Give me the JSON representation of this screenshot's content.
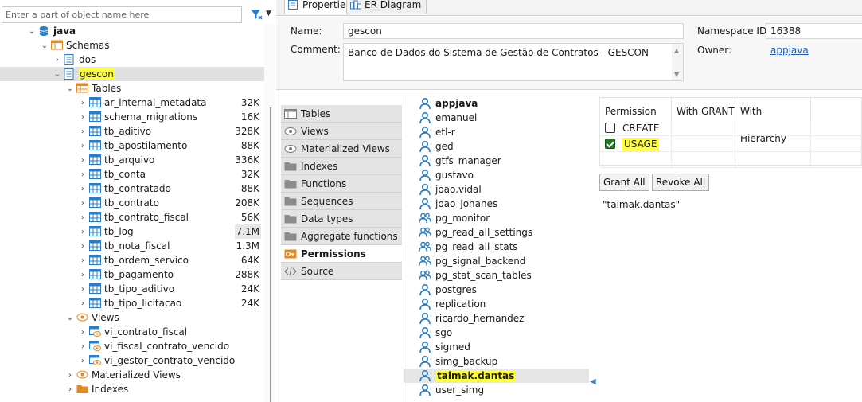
{
  "navigator": {
    "filter_placeholder": "Enter a part of object name here",
    "tree": {
      "database": "java",
      "schemas_label": "Schemas",
      "schemas": [
        "dos",
        "gescon"
      ],
      "tables_label": "Tables",
      "tables": [
        {
          "name": "ar_internal_metadata",
          "size": "32K"
        },
        {
          "name": "schema_migrations",
          "size": "16K"
        },
        {
          "name": "tb_aditivo",
          "size": "328K"
        },
        {
          "name": "tb_apostilamento",
          "size": "88K"
        },
        {
          "name": "tb_arquivo",
          "size": "336K"
        },
        {
          "name": "tb_conta",
          "size": "32K"
        },
        {
          "name": "tb_contratado",
          "size": "88K"
        },
        {
          "name": "tb_contrato",
          "size": "208K"
        },
        {
          "name": "tb_contrato_fiscal",
          "size": "56K"
        },
        {
          "name": "tb_log",
          "size": "7.1M"
        },
        {
          "name": "tb_nota_fiscal",
          "size": "1.3M"
        },
        {
          "name": "tb_ordem_servico",
          "size": "64K"
        },
        {
          "name": "tb_pagamento",
          "size": "288K"
        },
        {
          "name": "tb_tipo_aditivo",
          "size": "24K"
        },
        {
          "name": "tb_tipo_licitacao",
          "size": "24K"
        }
      ],
      "views_label": "Views",
      "views": [
        "vi_contrato_fiscal",
        "vi_fiscal_contrato_vencido",
        "vi_gestor_contrato_vencido"
      ],
      "materialized_views_label": "Materialized Views",
      "indexes_label": "Indexes"
    }
  },
  "editor": {
    "tabs": [
      "Properties",
      "ER Diagram"
    ],
    "properties": {
      "name_label": "Name:",
      "name_value": "gescon",
      "comment_label": "Comment:",
      "comment_value": "Banco de Dados do Sistema de Gestão de Contratos - GESCON",
      "namespace_label": "Namespace ID:",
      "namespace_value": "16388",
      "owner_label": "Owner:",
      "owner_value": "appjava"
    },
    "subtabs": [
      {
        "label": "Tables",
        "icon": "table-icon"
      },
      {
        "label": "Views",
        "icon": "eye-icon"
      },
      {
        "label": "Materialized Views",
        "icon": "eye-icon"
      },
      {
        "label": "Indexes",
        "icon": "folder-icon"
      },
      {
        "label": "Functions",
        "icon": "folder-icon"
      },
      {
        "label": "Sequences",
        "icon": "folder-icon"
      },
      {
        "label": "Data types",
        "icon": "folder-icon"
      },
      {
        "label": "Aggregate functions",
        "icon": "folder-icon"
      },
      {
        "label": "Permissions",
        "icon": "key-icon"
      },
      {
        "label": "Source",
        "icon": "source-icon"
      }
    ],
    "users": [
      {
        "name": "appjava",
        "kind": "user",
        "bold": true
      },
      {
        "name": "emanuel",
        "kind": "user"
      },
      {
        "name": "etl-r",
        "kind": "user"
      },
      {
        "name": "ged",
        "kind": "user"
      },
      {
        "name": "gtfs_manager",
        "kind": "user"
      },
      {
        "name": "gustavo",
        "kind": "user"
      },
      {
        "name": "joao.vidal",
        "kind": "user"
      },
      {
        "name": "joao_johanes",
        "kind": "user"
      },
      {
        "name": "pg_monitor",
        "kind": "group"
      },
      {
        "name": "pg_read_all_settings",
        "kind": "group"
      },
      {
        "name": "pg_read_all_stats",
        "kind": "group"
      },
      {
        "name": "pg_signal_backend",
        "kind": "group"
      },
      {
        "name": "pg_stat_scan_tables",
        "kind": "group"
      },
      {
        "name": "postgres",
        "kind": "user"
      },
      {
        "name": "replication",
        "kind": "user"
      },
      {
        "name": "ricardo_hernandez",
        "kind": "user"
      },
      {
        "name": "sgo",
        "kind": "user"
      },
      {
        "name": "sigmed",
        "kind": "user"
      },
      {
        "name": "simg_backup",
        "kind": "user"
      },
      {
        "name": "taimak.dantas",
        "kind": "user",
        "bold": true
      },
      {
        "name": "user_simg",
        "kind": "user"
      }
    ],
    "permissions": {
      "headers": [
        "Permission",
        "With GRANT",
        "With Hierarchy"
      ],
      "rows": [
        {
          "name": "CREATE",
          "checked": false
        },
        {
          "name": "USAGE",
          "checked": true
        }
      ],
      "grant_all": "Grant All",
      "revoke_all": "Revoke All",
      "grantee": "\"taimak.dantas\""
    }
  },
  "colors": {
    "highlight": "#ffff33",
    "link": "#1f5fbf",
    "check": "#1e7b1e",
    "icon_blue": "#2a7cc7",
    "icon_orange": "#e48a1f"
  }
}
